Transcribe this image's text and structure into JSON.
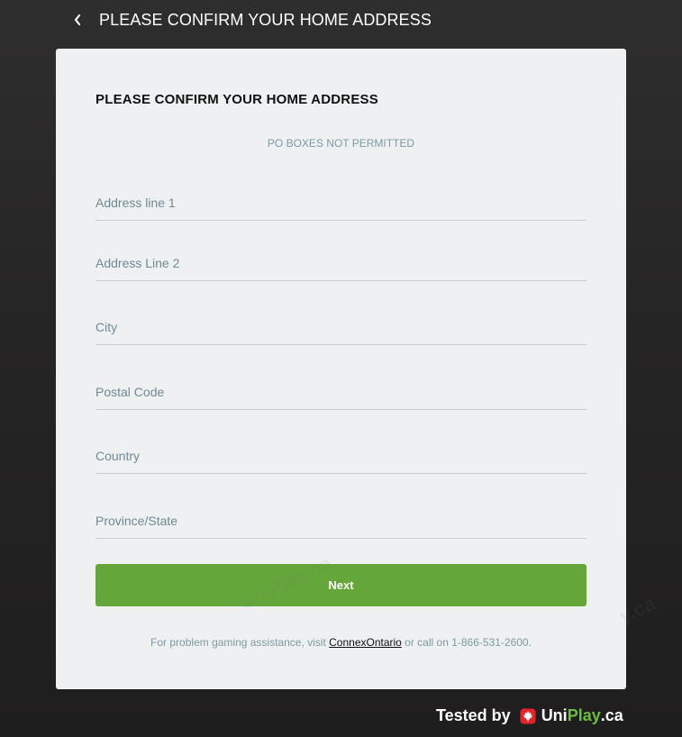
{
  "header": {
    "back_icon": "chevron-left-icon",
    "title": "PLEASE CONFIRM YOUR HOME ADDRESS"
  },
  "form": {
    "title": "PLEASE CONFIRM YOUR HOME ADDRESS",
    "notice": "PO BOXES NOT PERMITTED",
    "fields": [
      {
        "placeholder": "Address line 1",
        "value": ""
      },
      {
        "placeholder": "Address Line 2",
        "value": ""
      },
      {
        "placeholder": "City",
        "value": ""
      },
      {
        "placeholder": "Postal Code",
        "value": ""
      },
      {
        "placeholder": "Country",
        "value": ""
      },
      {
        "placeholder": "Province/State",
        "value": ""
      }
    ],
    "next_label": "Next",
    "help": {
      "prefix": "For problem gaming assistance, visit ",
      "link_text": "ConnexOntario",
      "suffix": " or call on 1-866-531-2600."
    }
  },
  "watermark": {
    "left_text": "UniPlay.ca",
    "right_text": "y.ca"
  },
  "footer": {
    "tested_by": "Tested by",
    "brand_uni": "Uni",
    "brand_play": "Play",
    "brand_tld": ".ca",
    "leaf_icon": "maple-leaf-icon"
  },
  "colors": {
    "accent_green": "#64a63a",
    "brand_green": "#6bbd3f",
    "leaf_red": "#e3242b",
    "card_bg": "#eef0f1",
    "muted_text": "#7d9aa4"
  }
}
